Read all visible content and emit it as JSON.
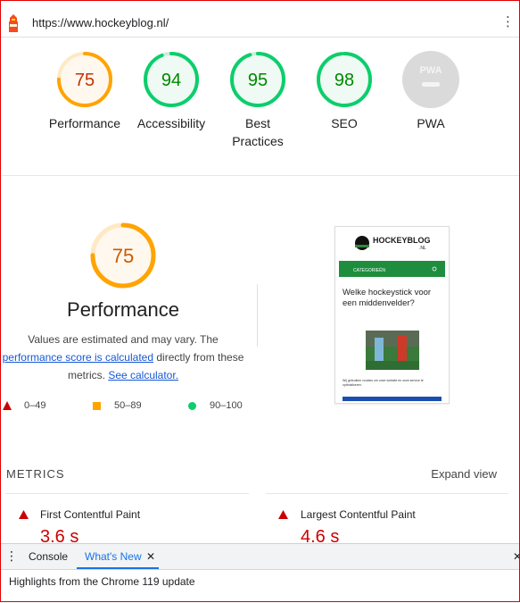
{
  "browser": {
    "url": "https://www.hockeyblog.nl/"
  },
  "colors": {
    "fail": "#cc0000",
    "average": "#ffa400",
    "pass": "#0cce6b",
    "pwa": "#d9d9d9"
  },
  "summary": [
    {
      "score": "75",
      "label": "Performance",
      "status": "average"
    },
    {
      "score": "94",
      "label": "Accessibility",
      "status": "pass"
    },
    {
      "score": "95",
      "label": "Best Practices",
      "status": "pass"
    },
    {
      "score": "98",
      "label": "SEO",
      "status": "pass"
    },
    {
      "score": "",
      "label": "PWA",
      "status": "pwa"
    }
  ],
  "performance": {
    "score": "75",
    "title": "Performance",
    "desc_prefix": "Values are estimated and may vary. The",
    "desc_link1": "performance score is calculated",
    "desc_middle": "directly from these metrics.",
    "desc_link2": "See calculator.",
    "legend": [
      {
        "range": "0–49",
        "icon": "triangle-icon"
      },
      {
        "range": "50–89",
        "icon": "square-icon"
      },
      {
        "range": "90–100",
        "icon": "circle-icon"
      }
    ]
  },
  "screenshot": {
    "logo_text": "HOCKEYBLOG",
    "logo_suffix": ".NL",
    "nav_label": "CATEGORIEËN",
    "heading": "Welke hockeystick voor een middenvelder?",
    "cookie_text": "Wij gebruiken cookies om onze website en onze service te optimaliseren."
  },
  "metrics": {
    "title": "METRICS",
    "expand_label": "Expand view",
    "items": [
      {
        "label": "First Contentful Paint",
        "value": "3.6 s"
      },
      {
        "label": "Largest Contentful Paint",
        "value": "4.6 s"
      }
    ]
  },
  "devtools": {
    "tabs": [
      "Console",
      "What's New"
    ],
    "close_label": "✕",
    "close_drawer": "✕",
    "highlights": "Highlights from the Chrome 119 update"
  }
}
